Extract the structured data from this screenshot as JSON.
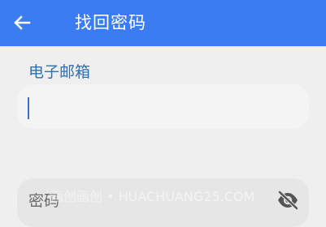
{
  "app_bar": {
    "title": "找回密码",
    "background_color": "#3b7cf3",
    "back_icon": "arrow-left-icon"
  },
  "form": {
    "email": {
      "label": "电子邮箱",
      "value": "",
      "label_color": "#2f6fb0"
    },
    "password": {
      "placeholder": "密码",
      "toggle_icon": "eye-off-icon"
    }
  },
  "watermark": {
    "text": "画创画创 • HUACHUANG25.COM"
  }
}
